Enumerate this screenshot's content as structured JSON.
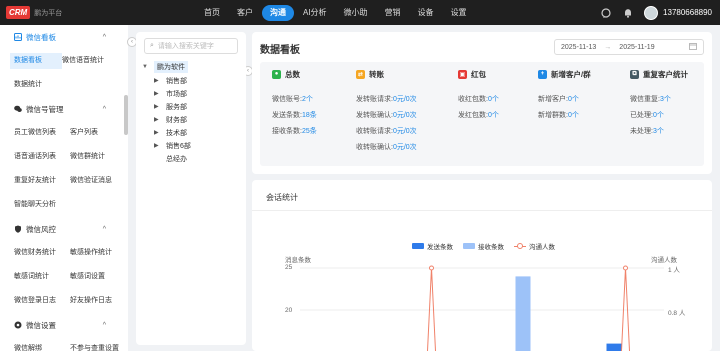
{
  "app": {
    "logo_badge": "CRM",
    "logo_text": "鹏为平台"
  },
  "topnav": {
    "items": [
      "首页",
      "客户",
      "沟通",
      "AI分析",
      "微小助",
      "营销",
      "设备",
      "设置"
    ],
    "active_index": 2
  },
  "user": {
    "phone": "13780668890"
  },
  "sidebar": {
    "groups": [
      {
        "label": "微信看板",
        "icon": "dashboard-icon",
        "expanded": true,
        "rows": [
          [
            "数据看板",
            "微信语音统计"
          ],
          [
            "数据统计"
          ]
        ]
      },
      {
        "label": "微信号管理",
        "icon": "wechat-icon",
        "expanded": true,
        "rows": [
          [
            "员工微信列表",
            "客户列表"
          ],
          [
            "语音通话列表",
            "微信群统计"
          ],
          [
            "重复好友统计",
            "微信验证消息"
          ],
          [
            "智能聊天分析"
          ]
        ]
      },
      {
        "label": "微信风控",
        "icon": "shield-icon",
        "expanded": true,
        "rows": [
          [
            "微信财务统计",
            "敏感操作统计"
          ],
          [
            "敏感词统计",
            "敏感词设置"
          ],
          [
            "微信登录日志",
            "好友操作日志"
          ]
        ]
      },
      {
        "label": "微信设置",
        "icon": "settings-icon",
        "expanded": true,
        "rows": [
          [
            "微信解绑",
            "不参与查重设置"
          ]
        ]
      }
    ],
    "active_item": "数据看板"
  },
  "tree": {
    "search_placeholder": "请输入搜索关键字",
    "root": "鹏为软件",
    "nodes": [
      "销售部",
      "市场部",
      "服务部",
      "财务部",
      "技术部",
      "销售6部",
      "总经办"
    ]
  },
  "dashboard": {
    "title": "数据看板",
    "date_start": "2025-11-13",
    "date_end": "2025-11-19",
    "date_separator": "→",
    "stats": [
      {
        "title": "总数",
        "icon": "wechat-icon",
        "color": "#2bb24c",
        "lines": [
          [
            "微信账号:",
            "2个"
          ],
          [
            "发送条数:",
            "18条"
          ],
          [
            "接收条数:",
            "25条"
          ]
        ]
      },
      {
        "title": "转账",
        "icon": "transfer-icon",
        "color": "#f5a623",
        "lines": [
          [
            "发转账请求:",
            "0元/0次"
          ],
          [
            "发转账确认:",
            "0元/0次"
          ],
          [
            "收转账请求:",
            "0元/0次"
          ],
          [
            "收转账确认:",
            "0元/0次"
          ]
        ]
      },
      {
        "title": "红包",
        "icon": "red-packet-icon",
        "color": "#e53935",
        "lines": [
          [
            "收红包数:",
            "0个"
          ],
          [
            "发红包数:",
            "0个"
          ]
        ]
      },
      {
        "title": "新增客户/群",
        "icon": "new-customer-icon",
        "color": "#1e88e5",
        "lines": [
          [
            "新增客户:",
            "0个"
          ],
          [
            "新增群数:",
            "0个"
          ]
        ]
      },
      {
        "title": "重复客户统计",
        "icon": "duplicate-icon",
        "color": "#455a64",
        "lines": [
          [
            "微信重复:",
            "3个"
          ],
          [
            "已处理:",
            "0个"
          ],
          [
            "未处理:",
            "3个"
          ]
        ]
      }
    ]
  },
  "session_chart": {
    "title": "会话统计",
    "left_axis_name": "消息条数",
    "right_axis_name": "沟通人数",
    "left_ticks": [
      "25",
      "20"
    ],
    "right_ticks": [
      "1 人",
      "0.8 人"
    ]
  },
  "chart_data": {
    "type": "bar",
    "legend": [
      "发送条数",
      "接收条数",
      "沟通人数"
    ],
    "series": [
      {
        "name": "发送条数",
        "type": "bar",
        "color": "#2f7bea",
        "visible_values": [
          {
            "index": 3,
            "value": 16
          }
        ]
      },
      {
        "name": "接收条数",
        "type": "bar",
        "color": "#9dc2f8",
        "visible_values": [
          {
            "index": 2,
            "value": 24
          }
        ]
      },
      {
        "name": "沟通人数",
        "type": "line",
        "color": "#f0826a",
        "visible_values": [
          {
            "index": 1,
            "value": 1
          },
          {
            "index": 3,
            "value": 1
          }
        ]
      }
    ],
    "y_left_ticks": [
      20,
      25
    ],
    "y_right_ticks": [
      0.8,
      1
    ]
  }
}
